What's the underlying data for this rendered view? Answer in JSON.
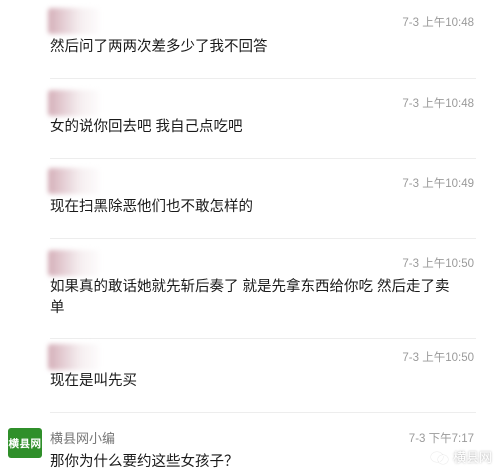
{
  "comments": [
    {
      "time": "7-3 上午10:48",
      "text": "然后问了两两次差多少了我不回答"
    },
    {
      "time": "7-3 上午10:48",
      "text": "女的说你回去吧  我自己点吃吧"
    },
    {
      "time": "7-3 上午10:49",
      "text": "现在扫黑除恶他们也不敢怎样的"
    },
    {
      "time": "7-3 上午10:50",
      "text": "如果真的敢话她就先斩后奏了  就是先拿东西给你吃  然后走了卖单"
    },
    {
      "time": "7-3 上午10:50",
      "text": "现在是叫先买"
    }
  ],
  "reply": {
    "logo_text": "横县网",
    "author": "横县网小编",
    "time": "7-3 下午7:17",
    "text": "那你为什么要约这些女孩子？"
  },
  "watermark": {
    "text": "横县网",
    "icon": "wechat-icon"
  }
}
